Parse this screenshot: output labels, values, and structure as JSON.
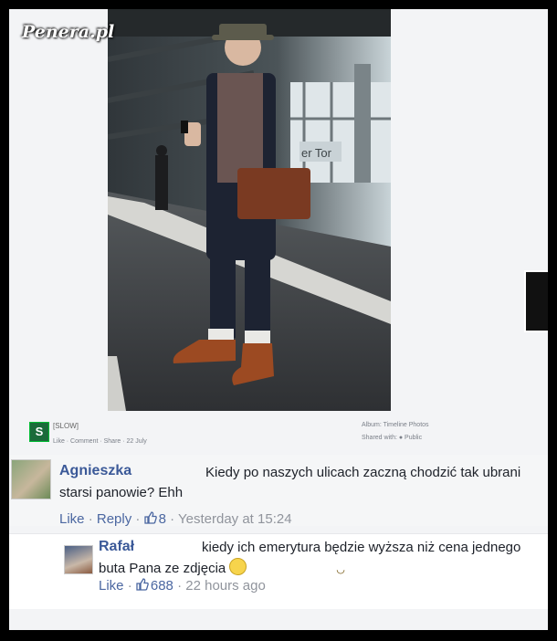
{
  "watermark": "Penera.pl",
  "post": {
    "page_name": "[SLOW]",
    "actions": "Like · Comment · Share · 22 July",
    "album": "Album: Timeline Photos",
    "shared_with": "Shared with: ● Public",
    "logo_letter": "S",
    "sign_text": "er Tor"
  },
  "comments": [
    {
      "author": "Agnieszka",
      "text": "Kiedy po naszych ulicach zaczną chodzić tak ubrani starsi panowie? Ehh",
      "like": "Like",
      "reply": "Reply",
      "likes": "8",
      "time": "Yesterday at 15:24"
    },
    {
      "author": "Rafał",
      "text": "kiedy ich emerytura będzie wyższa niż cena jednego buta Pana ze zdjęcia",
      "like": "Like",
      "likes": "688",
      "time": "22 hours ago"
    }
  ],
  "colors": {
    "link": "#3b5998",
    "meta": "#90949c",
    "background": "#f3f4f6"
  }
}
